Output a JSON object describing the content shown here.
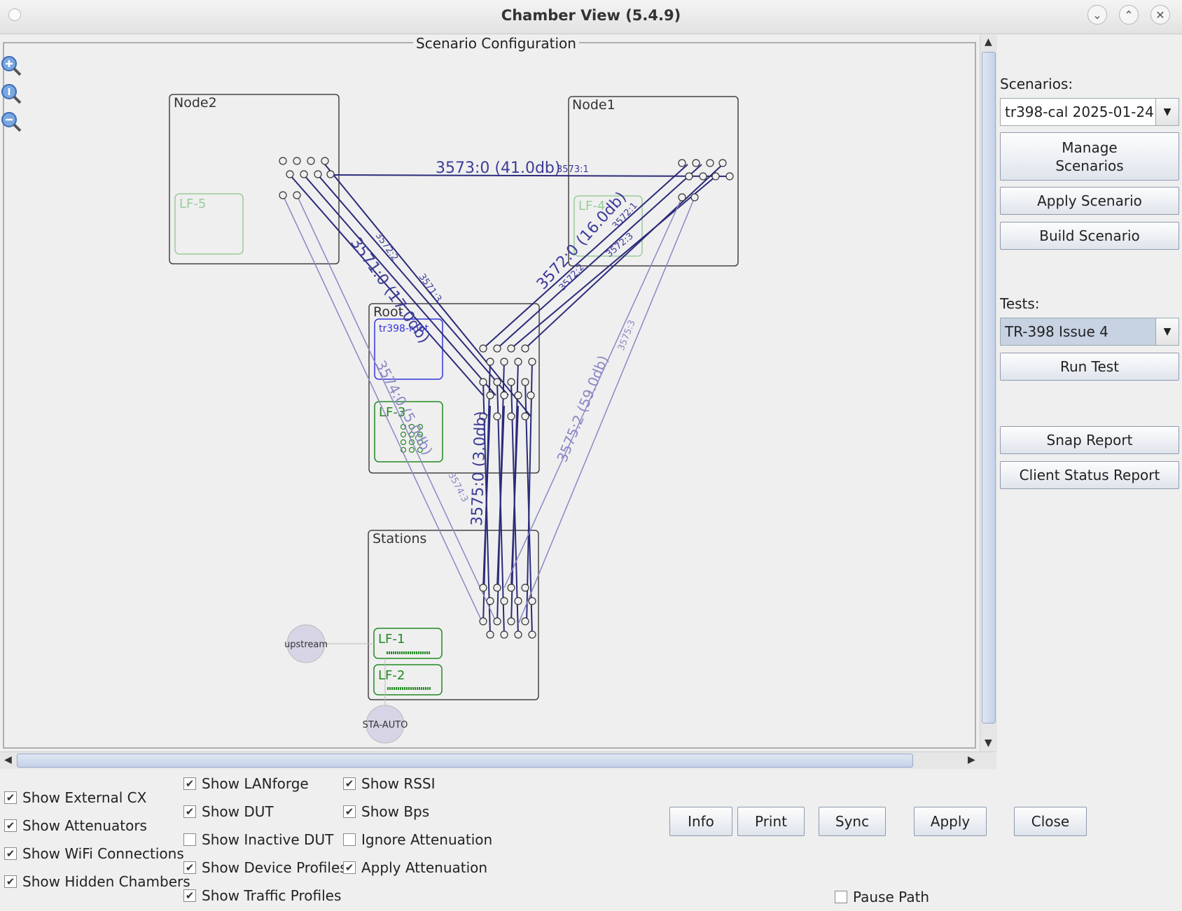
{
  "window": {
    "title": "Chamber View (5.4.9)"
  },
  "canvas": {
    "frame_title": "Scenario Configuration",
    "zoom_icons": [
      "zoom-in-icon",
      "zoom-reset-icon",
      "zoom-out-icon"
    ],
    "chambers": {
      "node2": {
        "label": "Node2",
        "devices": [
          "LF-5"
        ]
      },
      "node1": {
        "label": "Node1",
        "devices": [
          "LF-4"
        ]
      },
      "root": {
        "label": "Root",
        "devices": [
          "tr398-root",
          "LF-3"
        ]
      },
      "stations": {
        "label": "Stations",
        "devices": [
          "LF-1",
          "LF-2"
        ]
      }
    },
    "externals": [
      "upstream",
      "STA-AUTO"
    ],
    "attenuator_labels": {
      "a3573_0": "3573:0 (41.0db)",
      "a3573_1": "3573:1",
      "a3572_0": "3572:0 (16.0db)",
      "a3572_1": "3572:1",
      "a3572_2": "3572:2",
      "a3572_3": "3572:3",
      "a3571_0": "3571:0 (17.0db)",
      "a3571_3": "3571:3",
      "a3574_0": "3574:0 (5.0db)",
      "a3574_3": "3574:3",
      "a3575_0": "3575:0 (3.0db)",
      "a3575_2": "3575:2 (59.0db)",
      "a3575_3": "3575:3"
    }
  },
  "side": {
    "scenarios_label": "Scenarios:",
    "scenario_value": "tr398-cal 2025-01-24",
    "manage_scenarios_l1": "Manage",
    "manage_scenarios_l2": "Scenarios",
    "apply_scenario": "Apply Scenario",
    "build_scenario": "Build Scenario",
    "tests_label": "Tests:",
    "test_value": "TR-398 Issue 4",
    "run_test": "Run Test",
    "snap_report": "Snap Report",
    "client_status_report": "Client Status Report"
  },
  "options": [
    {
      "label": "Show External CX",
      "checked": true
    },
    {
      "label": "Show Attenuators",
      "checked": true
    },
    {
      "label": "Show WiFi Connections",
      "checked": true
    },
    {
      "label": "Show Hidden Chambers",
      "checked": true
    },
    {
      "label": "Show LANforge",
      "checked": true
    },
    {
      "label": "Show DUT",
      "checked": true
    },
    {
      "label": "Show Inactive DUT",
      "checked": false
    },
    {
      "label": "Show Device Profiles",
      "checked": true
    },
    {
      "label": "Show Traffic Profiles",
      "checked": true
    },
    {
      "label": "Show RSSI",
      "checked": true
    },
    {
      "label": "Show Bps",
      "checked": true
    },
    {
      "label": "Ignore Attenuation",
      "checked": false
    },
    {
      "label": "Apply Attenuation",
      "checked": true
    },
    {
      "label": "Pause Path",
      "checked": false
    }
  ],
  "buttons": {
    "info": "Info",
    "print": "Print",
    "sync": "Sync",
    "apply": "Apply",
    "close": "Close"
  },
  "checkmark": "✔"
}
